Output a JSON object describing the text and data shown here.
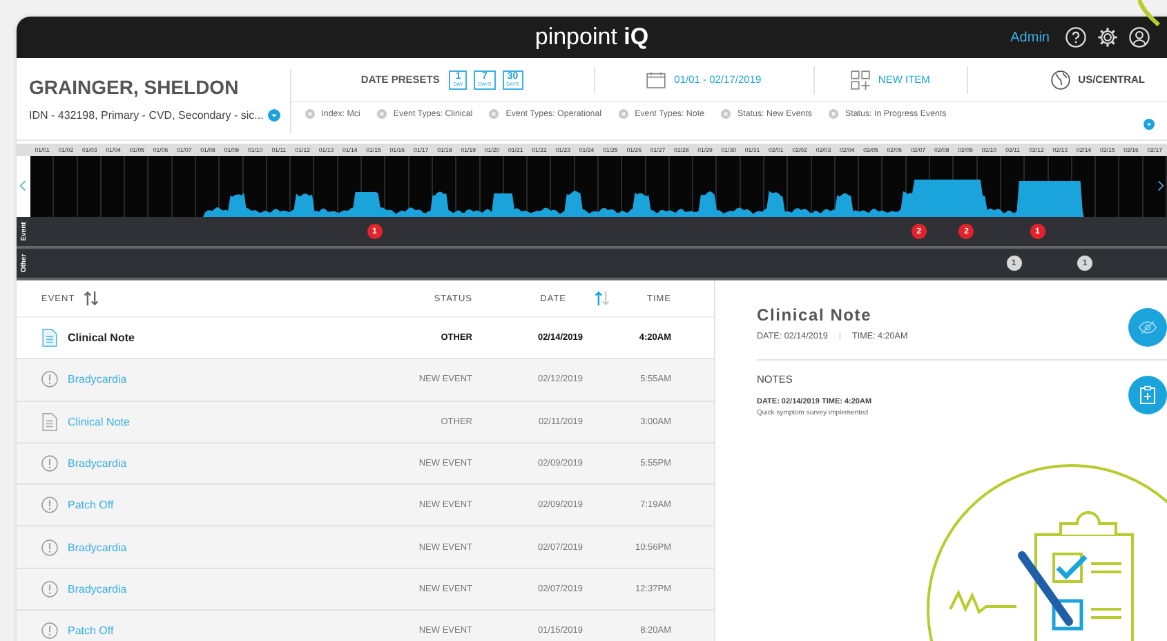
{
  "top_bar": {
    "logo": {
      "word": "pinpoint",
      "mark": "iQ"
    },
    "user": "Admin"
  },
  "patient": {
    "name": "GRAINGER, SHELDON",
    "details": "IDN - 432198, Primary - CVD, Secondary - sic..."
  },
  "date_presets": {
    "label": "DATE PRESETS",
    "buttons": [
      {
        "number": "1",
        "unit": "DAY"
      },
      {
        "number": "7",
        "unit": "DAYS"
      },
      {
        "number": "30",
        "unit": "DAYS"
      }
    ]
  },
  "date_range": "01/01 - 02/17/2019",
  "new_item": "NEW ITEM",
  "timezone": "US/CENTRAL",
  "filters": [
    "Index: Mci",
    "Event Types: Clinical",
    "Event Types: Operational",
    "Event Types: Note",
    "Status: New Events",
    "Status: In Progress Events"
  ],
  "timeline": {
    "lanes": [
      {
        "label": "Event",
        "kind": "event"
      },
      {
        "label": "Other",
        "kind": "other"
      }
    ],
    "days": [
      {
        "date": "01/01"
      },
      {
        "date": "01/02"
      },
      {
        "date": "01/03"
      },
      {
        "date": "01/04"
      },
      {
        "date": "01/05"
      },
      {
        "date": "01/06"
      },
      {
        "date": "01/07"
      },
      {
        "date": "01/08"
      },
      {
        "date": "01/09"
      },
      {
        "date": "01/10"
      },
      {
        "date": "01/11"
      },
      {
        "date": "01/12"
      },
      {
        "date": "01/13"
      },
      {
        "date": "01/14"
      },
      {
        "date": "01/15",
        "event_marker": {
          "count": "1",
          "color": "#e3232b"
        }
      },
      {
        "date": "01/16"
      },
      {
        "date": "01/17"
      },
      {
        "date": "01/18"
      },
      {
        "date": "01/19"
      },
      {
        "date": "01/20"
      },
      {
        "date": "01/21"
      },
      {
        "date": "01/22"
      },
      {
        "date": "01/23"
      },
      {
        "date": "01/24"
      },
      {
        "date": "01/25"
      },
      {
        "date": "01/26"
      },
      {
        "date": "01/27"
      },
      {
        "date": "01/28"
      },
      {
        "date": "01/29"
      },
      {
        "date": "01/30"
      },
      {
        "date": "01/31"
      },
      {
        "date": "02/01"
      },
      {
        "date": "02/02"
      },
      {
        "date": "02/03"
      },
      {
        "date": "02/04"
      },
      {
        "date": "02/05"
      },
      {
        "date": "02/06"
      },
      {
        "date": "02/07",
        "event_marker": {
          "count": "2",
          "color": "#e3232b"
        }
      },
      {
        "date": "02/08"
      },
      {
        "date": "02/09",
        "event_marker": {
          "count": "2",
          "color": "#e3232b"
        }
      },
      {
        "date": "02/10"
      },
      {
        "date": "02/11",
        "other_marker": {
          "count": "1",
          "color": "#d9d9d9"
        }
      },
      {
        "date": "02/12",
        "event_marker": {
          "count": "1",
          "color": "#e3232b"
        }
      },
      {
        "date": "02/13"
      },
      {
        "date": "02/14",
        "other_marker": {
          "count": "1",
          "color": "#d9d9d9"
        }
      },
      {
        "date": "02/15"
      },
      {
        "date": "02/16"
      },
      {
        "date": "02/17"
      }
    ]
  },
  "table": {
    "columns": [
      {
        "label": "EVENT",
        "sortable": true,
        "sorted": false
      },
      {
        "label": "STATUS",
        "sortable": false,
        "sorted": false
      },
      {
        "label": "DATE",
        "sortable": true,
        "sorted": true
      },
      {
        "label": "TIME",
        "sortable": false,
        "sorted": false
      }
    ],
    "rows": [
      {
        "kind": "note",
        "event": "Clinical Note",
        "status": "OTHER",
        "date": "02/14/2019",
        "time": "4:20AM",
        "selected": true
      },
      {
        "kind": "alert",
        "event": "Bradycardia",
        "status": "NEW EVENT",
        "date": "02/12/2019",
        "time": "5:55AM",
        "selected": false
      },
      {
        "kind": "note",
        "event": "Clinical Note",
        "status": "OTHER",
        "date": "02/11/2019",
        "time": "3:00AM",
        "selected": false
      },
      {
        "kind": "alert",
        "event": "Bradycardia",
        "status": "NEW EVENT",
        "date": "02/09/2019",
        "time": "5:55PM",
        "selected": false
      },
      {
        "kind": "alert",
        "event": "Patch Off",
        "status": "NEW EVENT",
        "date": "02/09/2019",
        "time": "7:19AM",
        "selected": false
      },
      {
        "kind": "alert",
        "event": "Bradycardia",
        "status": "NEW EVENT",
        "date": "02/07/2019",
        "time": "10:56PM",
        "selected": false
      },
      {
        "kind": "alert",
        "event": "Bradycardia",
        "status": "NEW EVENT",
        "date": "02/07/2019",
        "time": "12:37PM",
        "selected": false
      },
      {
        "kind": "alert",
        "event": "Patch Off",
        "status": "NEW EVENT",
        "date": "01/15/2019",
        "time": "8:20AM",
        "selected": false
      }
    ]
  },
  "detail": {
    "title": "Clinical Note",
    "date": "DATE: 02/14/2019",
    "separator": "|",
    "time": "TIME: 4:20AM",
    "notes_heading": "NOTES",
    "note_meta": "DATE: 02/14/2019 TIME: 4:20AM",
    "note_text": "Quick symptom survey implemented"
  }
}
